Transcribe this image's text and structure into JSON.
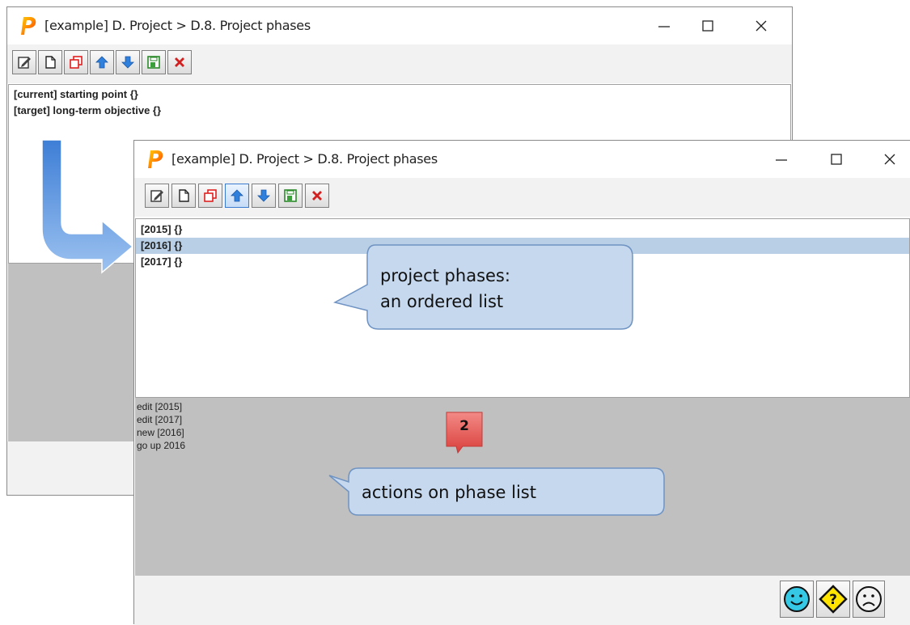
{
  "window": {
    "title": "[example] D. Project > D.8. Project phases"
  },
  "toolbar": {
    "buttons": [
      {
        "name": "edit-icon"
      },
      {
        "name": "new-document-icon"
      },
      {
        "name": "copy-icon"
      },
      {
        "name": "move-up-icon"
      },
      {
        "name": "move-down-icon"
      },
      {
        "name": "save-icon"
      },
      {
        "name": "delete-icon"
      }
    ]
  },
  "back_list": {
    "items": [
      {
        "label": "[current] starting point {}"
      },
      {
        "label": "[target] long-term objective {}"
      }
    ]
  },
  "front_list": {
    "items": [
      {
        "label": "[2015]  {}",
        "selected": false
      },
      {
        "label": "[2016]  {}",
        "selected": true
      },
      {
        "label": "[2017]  {}",
        "selected": false
      }
    ]
  },
  "actions": {
    "items": [
      "edit [2015]",
      "edit [2017]",
      "new [2016]",
      "go up 2016"
    ]
  },
  "callouts": {
    "phases_line1": "project phases:",
    "phases_line2": "an ordered list",
    "actions": "actions on phase list",
    "badge": "2"
  },
  "feedback": {
    "buttons": [
      {
        "name": "happy-face-icon",
        "color": "#35c9e6"
      },
      {
        "name": "question-icon",
        "color": "#ffe400"
      },
      {
        "name": "sad-face-icon",
        "color": "#f2f2f2"
      }
    ]
  },
  "colors": {
    "selection": "#b8cfe6",
    "callout_fill": "#c5d8ee",
    "callout_border": "#6f93c2",
    "badge": "#e7514f",
    "arrow": "#4a86d8"
  }
}
